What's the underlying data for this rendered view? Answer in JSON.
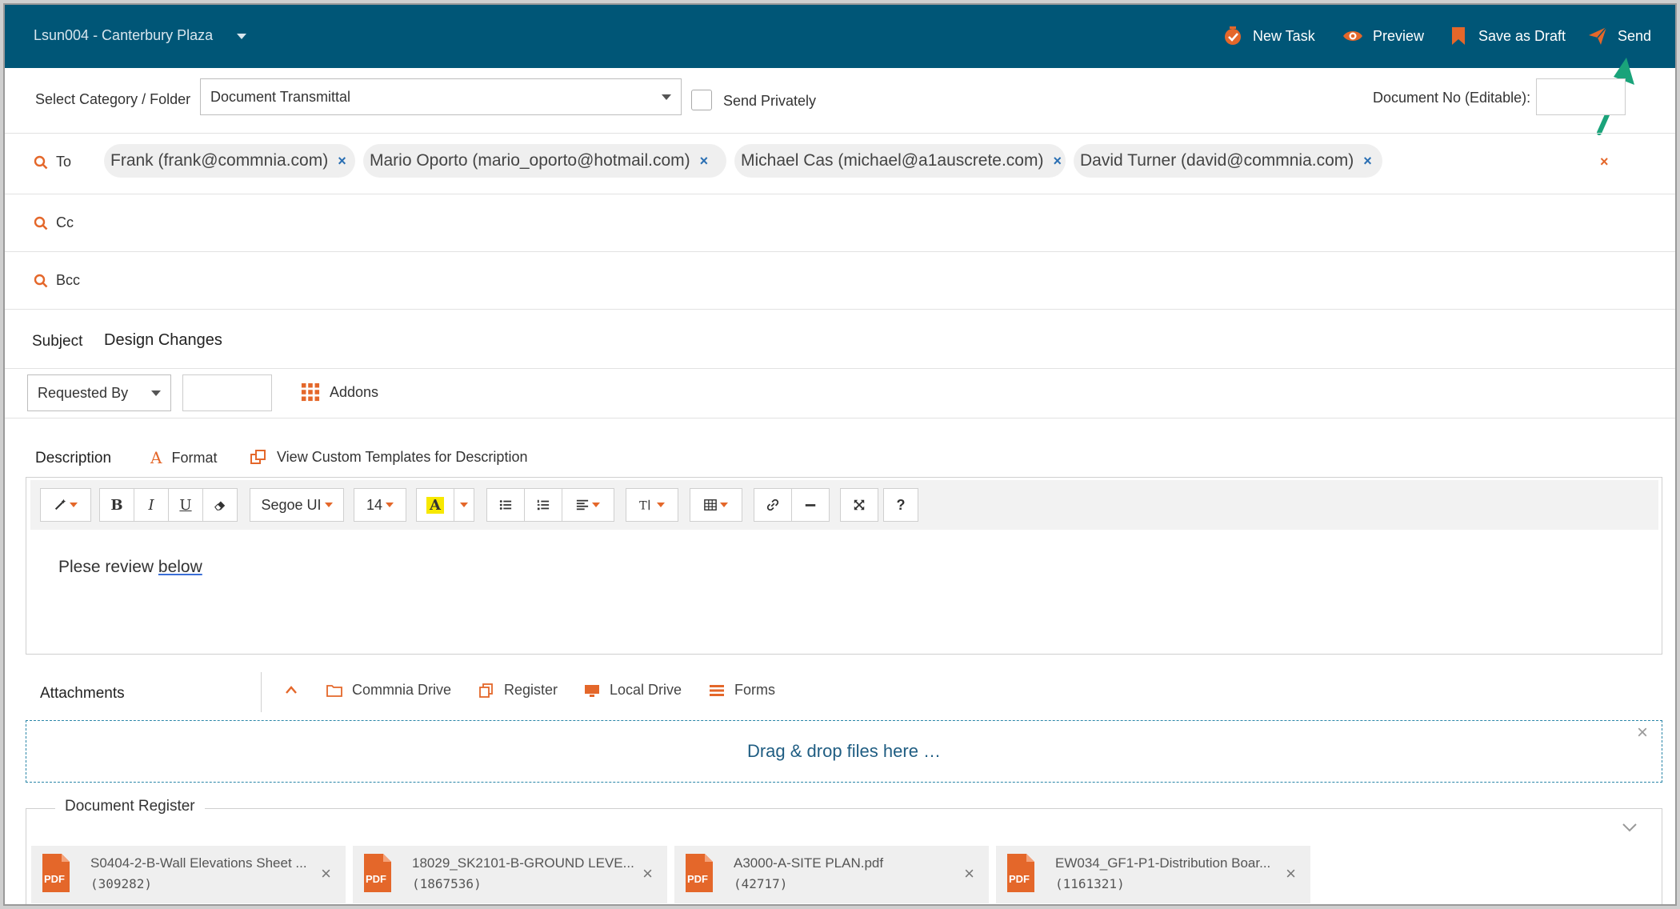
{
  "header": {
    "project": "Lsun004 - Canterbury Plaza",
    "actions": {
      "new_task": "New Task",
      "preview": "Preview",
      "save_draft": "Save as Draft",
      "send": "Send"
    }
  },
  "form": {
    "category_label": "Select Category / Folder",
    "category_value": "Document Transmittal",
    "send_privately": "Send Privately",
    "doc_no_label": "Document No (Editable):",
    "to_label": "To",
    "cc_label": "Cc",
    "bcc_label": "Bcc",
    "recipients": [
      "Frank (frank@commnia.com)",
      "Mario Oporto (mario_oporto@hotmail.com)",
      "Michael Cas (michael@a1auscrete.com)",
      "David Turner (david@commnia.com)"
    ],
    "recipient_remove": "×",
    "clear_all": "×",
    "subject_label": "Subject",
    "subject_value": "Design Changes",
    "requested_by": "Requested By",
    "addons": "Addons",
    "description_label": "Description",
    "format": "Format",
    "view_templates": "View Custom Templates for Description"
  },
  "editor": {
    "font_name": "Segoe UI",
    "font_size": "14",
    "bold": "B",
    "italic": "I",
    "underline": "U",
    "help": "?",
    "text_before": "Plese review ",
    "text_underlined": "below"
  },
  "attachments": {
    "label": "Attachments",
    "sources": [
      "Commnia Drive",
      "Register",
      "Local Drive",
      "Forms"
    ],
    "dropzone": "Drag & drop files here …",
    "dropzone_close": "×"
  },
  "document_register": {
    "title": "Document Register",
    "pdf_label": "PDF",
    "files": [
      {
        "name": "S0404-2-B-Wall Elevations Sheet ...",
        "size": "(309282)"
      },
      {
        "name": "18029_SK2101-B-GROUND LEVE...",
        "size": "(1867536)"
      },
      {
        "name": "A3000-A-SITE PLAN.pdf",
        "size": "(42717)"
      },
      {
        "name": "EW034_GF1-P1-Distribution Boar...",
        "size": "(1161321)"
      }
    ],
    "remove": "×"
  },
  "colors": {
    "header_bg": "#005677",
    "accent": "#e4672a",
    "annotation_arrow": "#1aa37a"
  }
}
